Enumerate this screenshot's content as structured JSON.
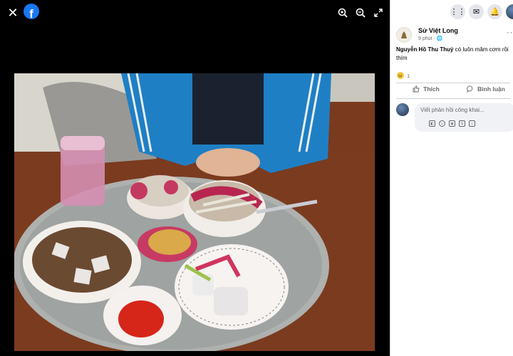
{
  "viewer": {
    "close_icon": "✕",
    "logo_letter": "f",
    "zoom_in_icon": "zoom-in-icon",
    "zoom_out_icon": "zoom-out-icon",
    "fullscreen_icon": "fullscreen-icon"
  },
  "nav": {
    "menu_icon": "⋮⋮",
    "messenger_icon": "✉",
    "notifications_icon": "🔔"
  },
  "post": {
    "author": "Sử Việt Long",
    "time": "9 phút ·",
    "time_icon": "🌐",
    "more": "···",
    "mention": "Nguyễn Hồ Thu Thuỷ",
    "text": " có luôn mâm cơm rồi thím",
    "reaction_icon": "😆",
    "reaction_count": "1"
  },
  "actions": {
    "like": "Thích",
    "comment": "Bình luận"
  },
  "comment": {
    "placeholder": "Viết phản hồi công khai...",
    "send_icon": "➤"
  },
  "colors": {
    "facebook_blue": "#1877f2",
    "panel_bg": "#ffffff",
    "viewer_bg": "#000000"
  }
}
